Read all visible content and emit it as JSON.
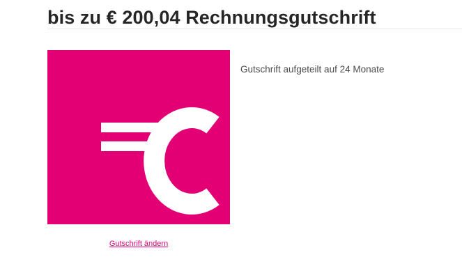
{
  "header": {
    "title": "bis zu € 200,04 Rechnungsgutschrift"
  },
  "offer": {
    "icon": "euro-icon",
    "icon_background": "#e20074",
    "description": "Gutschrift aufgeteilt auf 24 Monate",
    "change_link_label": "Gutschrift ändern"
  },
  "colors": {
    "accent": "#e20074",
    "heading": "#262626",
    "body_text": "#4b4b4b"
  }
}
